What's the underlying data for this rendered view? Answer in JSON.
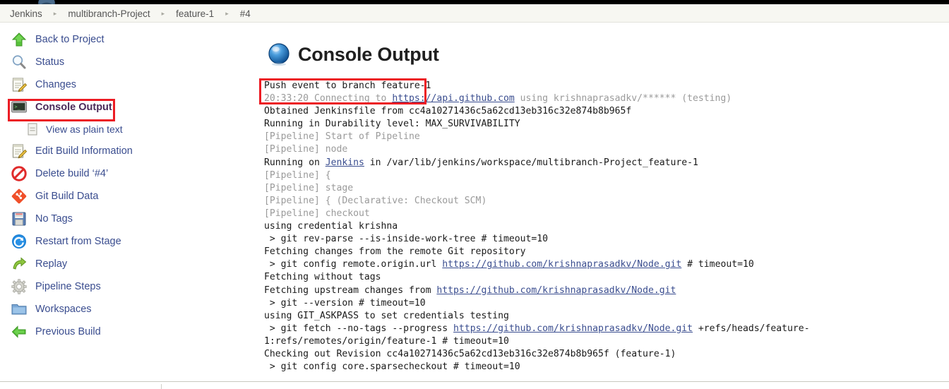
{
  "breadcrumbs": [
    {
      "label": "Jenkins"
    },
    {
      "label": "multibranch-Project"
    },
    {
      "label": "feature-1"
    },
    {
      "label": "#4"
    }
  ],
  "breadcrumb_separator": "▸",
  "sidebar": {
    "items": [
      {
        "label": "Back to Project",
        "icon": "up-arrow-icon",
        "current": false,
        "sub": false
      },
      {
        "label": "Status",
        "icon": "magnifier-icon",
        "current": false,
        "sub": false
      },
      {
        "label": "Changes",
        "icon": "notepad-pencil-icon",
        "current": false,
        "sub": false
      },
      {
        "label": "Console Output",
        "icon": "terminal-icon",
        "current": true,
        "sub": false
      },
      {
        "label": "View as plain text",
        "icon": "document-icon",
        "current": false,
        "sub": true
      },
      {
        "label": "Edit Build Information",
        "icon": "notepad-pencil-icon",
        "current": false,
        "sub": false
      },
      {
        "label": "Delete build ‘#4’",
        "icon": "no-entry-icon",
        "current": false,
        "sub": false
      },
      {
        "label": "Git Build Data",
        "icon": "git-diamond-icon",
        "current": false,
        "sub": false
      },
      {
        "label": "No Tags",
        "icon": "floppy-disk-icon",
        "current": false,
        "sub": false
      },
      {
        "label": "Restart from Stage",
        "icon": "restart-circle-icon",
        "current": false,
        "sub": false
      },
      {
        "label": "Replay",
        "icon": "replay-arrow-icon",
        "current": false,
        "sub": false
      },
      {
        "label": "Pipeline Steps",
        "icon": "gear-icon",
        "current": false,
        "sub": false
      },
      {
        "label": "Workspaces",
        "icon": "folder-icon",
        "current": false,
        "sub": false
      },
      {
        "label": "Previous Build",
        "icon": "left-arrow-icon",
        "current": false,
        "sub": false
      }
    ]
  },
  "main": {
    "title": "Console Output",
    "title_icon": "blue-ball-icon"
  },
  "console": {
    "lines": [
      {
        "style": "normal",
        "segments": [
          {
            "t": "Push event to branch feature-1"
          }
        ]
      },
      {
        "style": "normal",
        "segments": [
          {
            "t": "20:33:20 Connecting to ",
            "cls": "ts"
          },
          {
            "t": "https://api.github.com",
            "link": true
          },
          {
            "t": " using krishnaprasadkv/****** (testing)",
            "cls": "ts"
          }
        ]
      },
      {
        "style": "normal",
        "segments": [
          {
            "t": "Obtained Jenkinsfile from cc4a10271436c5a62cd13eb316c32e874b8b965f"
          }
        ]
      },
      {
        "style": "normal",
        "segments": [
          {
            "t": "Running in Durability level: MAX_SURVIVABILITY"
          }
        ]
      },
      {
        "style": "pipeline",
        "segments": [
          {
            "t": "[Pipeline] Start of Pipeline"
          }
        ]
      },
      {
        "style": "pipeline",
        "segments": [
          {
            "t": "[Pipeline] node"
          }
        ]
      },
      {
        "style": "normal",
        "segments": [
          {
            "t": "Running on "
          },
          {
            "t": "Jenkins",
            "link": true
          },
          {
            "t": " in /var/lib/jenkins/workspace/multibranch-Project_feature-1"
          }
        ]
      },
      {
        "style": "pipeline",
        "segments": [
          {
            "t": "[Pipeline] {"
          }
        ]
      },
      {
        "style": "pipeline",
        "segments": [
          {
            "t": "[Pipeline] stage"
          }
        ]
      },
      {
        "style": "pipeline",
        "segments": [
          {
            "t": "[Pipeline] { (Declarative: Checkout SCM)"
          }
        ]
      },
      {
        "style": "pipeline",
        "segments": [
          {
            "t": "[Pipeline] checkout"
          }
        ]
      },
      {
        "style": "normal",
        "segments": [
          {
            "t": "using credential krishna"
          }
        ]
      },
      {
        "style": "normal",
        "segments": [
          {
            "t": " > git rev-parse --is-inside-work-tree # timeout=10"
          }
        ]
      },
      {
        "style": "normal",
        "segments": [
          {
            "t": "Fetching changes from the remote Git repository"
          }
        ]
      },
      {
        "style": "normal",
        "segments": [
          {
            "t": " > git config remote.origin.url "
          },
          {
            "t": "https://github.com/krishnaprasadkv/Node.git",
            "link": true
          },
          {
            "t": " # timeout=10"
          }
        ]
      },
      {
        "style": "normal",
        "segments": [
          {
            "t": "Fetching without tags"
          }
        ]
      },
      {
        "style": "normal",
        "segments": [
          {
            "t": "Fetching upstream changes from "
          },
          {
            "t": "https://github.com/krishnaprasadkv/Node.git",
            "link": true
          }
        ]
      },
      {
        "style": "normal",
        "segments": [
          {
            "t": " > git --version # timeout=10"
          }
        ]
      },
      {
        "style": "normal",
        "segments": [
          {
            "t": "using GIT_ASKPASS to set credentials testing"
          }
        ]
      },
      {
        "style": "normal",
        "segments": [
          {
            "t": " > git fetch --no-tags --progress "
          },
          {
            "t": "https://github.com/krishnaprasadkv/Node.git",
            "link": true
          },
          {
            "t": " +refs/heads/feature-1:refs/remotes/origin/feature-1 # timeout=10"
          }
        ]
      },
      {
        "style": "normal",
        "segments": [
          {
            "t": "Checking out Revision cc4a10271436c5a62cd13eb316c32e874b8b965f (feature-1)"
          }
        ]
      },
      {
        "style": "normal",
        "segments": [
          {
            "t": " > git config core.sparsecheckout # timeout=10"
          }
        ]
      }
    ]
  },
  "annotations": {
    "console_nav_highlight": "#ec1c24",
    "push_event_highlight": "#ec1c24"
  }
}
